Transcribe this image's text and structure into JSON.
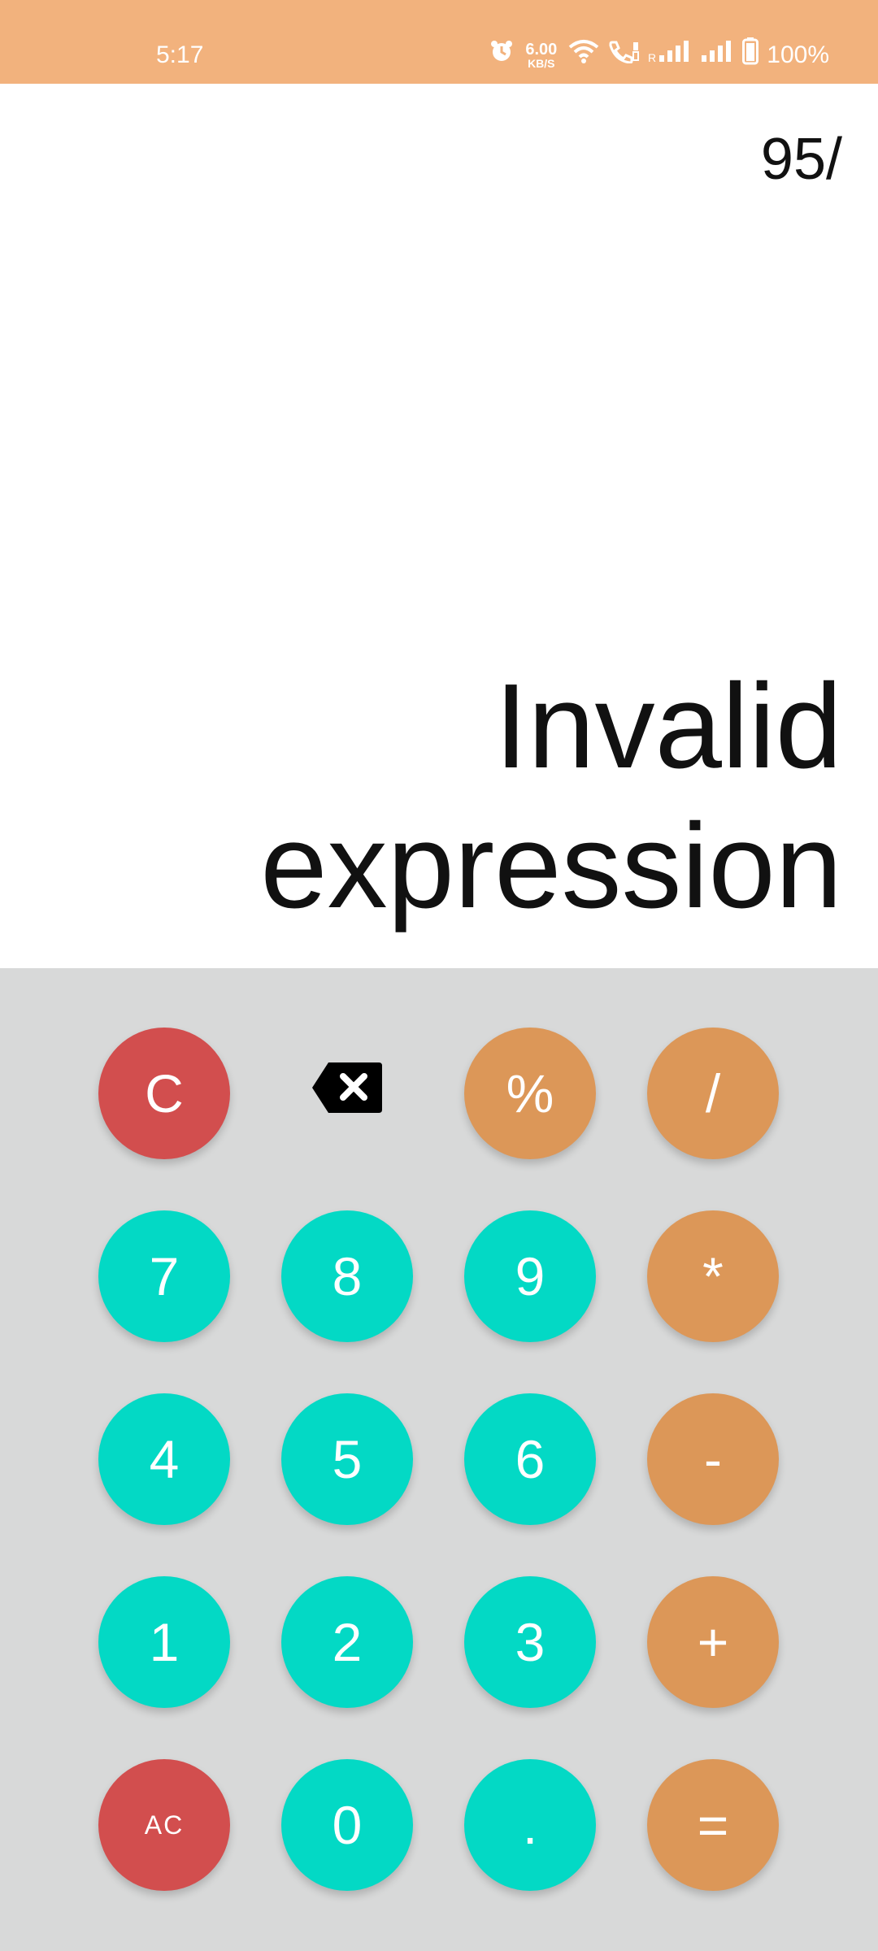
{
  "status_bar": {
    "time": "5:17",
    "net_speed_value": "6.00",
    "net_speed_unit": "KB/S",
    "sim_label": "R",
    "battery": "100%",
    "background_color": "#F2B27D",
    "icons": [
      "alarm-icon",
      "wifi-icon",
      "volte-call-icon",
      "signal-icon",
      "signal-icon",
      "battery-icon"
    ]
  },
  "display": {
    "expression": "95/",
    "result_line1": "Invalid",
    "result_line2": "expression"
  },
  "keypad": {
    "row1": {
      "clear": "C",
      "backspace_icon": "backspace-icon",
      "percent": "%",
      "divide": "/"
    },
    "row2": {
      "seven": "7",
      "eight": "8",
      "nine": "9",
      "multiply": "*"
    },
    "row3": {
      "four": "4",
      "five": "5",
      "six": "6",
      "minus": "-"
    },
    "row4": {
      "one": "1",
      "two": "2",
      "three": "3",
      "plus": "+"
    },
    "row5": {
      "all_clear": "AC",
      "zero": "0",
      "dot": ".",
      "equals": "="
    },
    "colors": {
      "number": "#03D9C5",
      "operator": "#DC9758",
      "clear": "#D24E4E",
      "keypad_bg": "#D8D9D9"
    }
  }
}
